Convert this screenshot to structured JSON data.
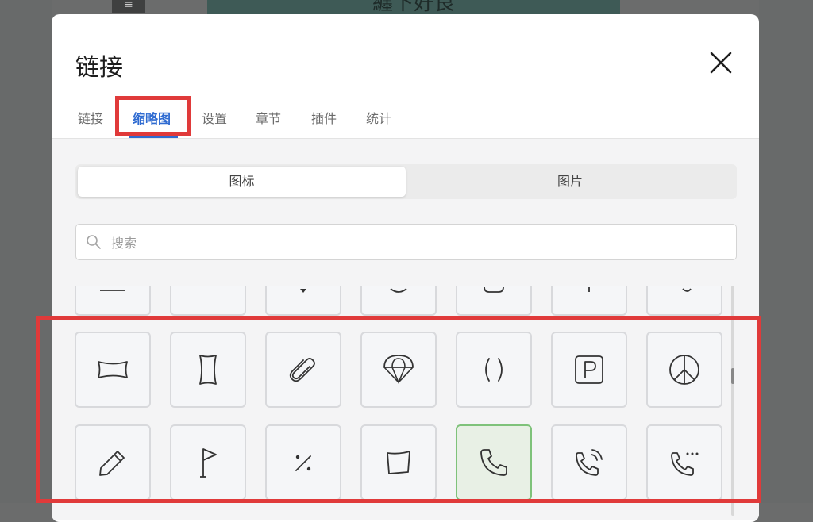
{
  "background": {
    "menu_glyph": "≡",
    "banner_text": "纏下好良"
  },
  "dialog": {
    "title": "链接",
    "close_icon": "close-icon"
  },
  "tabs": [
    {
      "label": "链接"
    },
    {
      "label": "缩略图",
      "active": true
    },
    {
      "label": "设置"
    },
    {
      "label": "章节"
    },
    {
      "label": "插件"
    },
    {
      "label": "统计"
    }
  ],
  "segmented": {
    "options": [
      {
        "label": "图标",
        "active": true
      },
      {
        "label": "图片"
      }
    ]
  },
  "search": {
    "placeholder": "搜索",
    "value": ""
  },
  "icons": [
    {
      "name": "partial-icon-1"
    },
    {
      "name": "partial-icon-2"
    },
    {
      "name": "partial-icon-3"
    },
    {
      "name": "partial-icon-4"
    },
    {
      "name": "partial-icon-5"
    },
    {
      "name": "partial-icon-6"
    },
    {
      "name": "partial-icon-7"
    },
    {
      "name": "banner-horizontal-icon"
    },
    {
      "name": "banner-vertical-icon"
    },
    {
      "name": "paperclip-icon"
    },
    {
      "name": "parachute-icon"
    },
    {
      "name": "parentheses-icon"
    },
    {
      "name": "parking-icon"
    },
    {
      "name": "peace-icon"
    },
    {
      "name": "pencil-icon"
    },
    {
      "name": "pennant-flag-icon"
    },
    {
      "name": "percent-icon"
    },
    {
      "name": "perspective-square-icon"
    },
    {
      "name": "phone-icon",
      "selected": true
    },
    {
      "name": "phone-calling-icon"
    },
    {
      "name": "phone-more-icon"
    }
  ],
  "colors": {
    "accent": "#2f6bd1",
    "highlight": "#e03a3a",
    "selected_border": "#7fc27a"
  }
}
